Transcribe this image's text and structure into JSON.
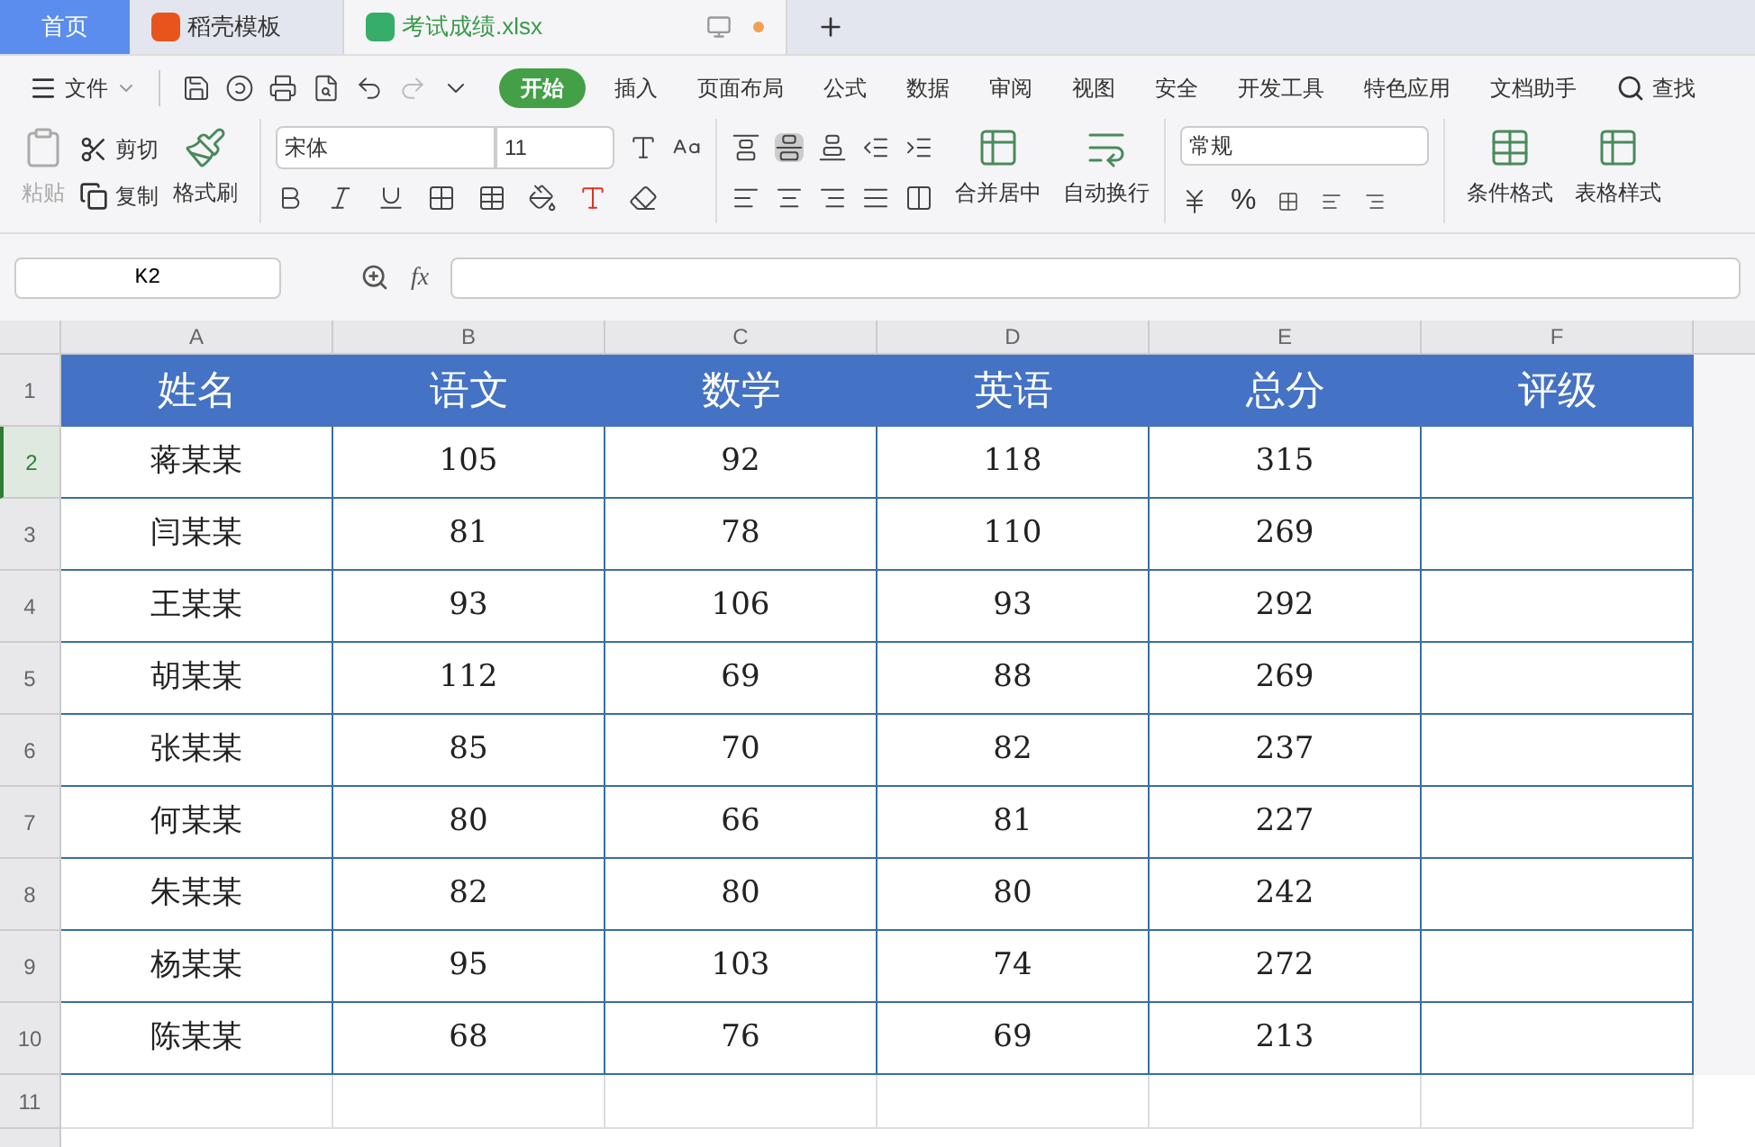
{
  "tabs": [
    {
      "label": "首页",
      "kind": "home",
      "selected": false
    },
    {
      "label": "稻壳模板",
      "kind": "template",
      "selected": false
    },
    {
      "label": "考试成绩.xlsx",
      "kind": "sheet",
      "selected": true
    }
  ],
  "menu": {
    "file": "文件",
    "items": [
      {
        "label": "开始",
        "selected": true
      },
      {
        "label": "插入",
        "selected": false
      },
      {
        "label": "页面布局",
        "selected": false
      },
      {
        "label": "公式",
        "selected": false
      },
      {
        "label": "数据",
        "selected": false
      },
      {
        "label": "审阅",
        "selected": false
      },
      {
        "label": "视图",
        "selected": false
      },
      {
        "label": "安全",
        "selected": false
      },
      {
        "label": "开发工具",
        "selected": false
      },
      {
        "label": "特色应用",
        "selected": false
      },
      {
        "label": "文档助手",
        "selected": false
      }
    ],
    "search": "查找"
  },
  "ribbon": {
    "paste": "粘贴",
    "cut": "剪切",
    "copy": "复制",
    "format_painter": "格式刷",
    "font": "宋体",
    "font_size": "11",
    "merge": "合并居中",
    "wrap": "自动换行",
    "number_format": "常规",
    "percent": "%",
    "conditional_format": "条件格式",
    "table_style": "表格样式"
  },
  "formula_bar": {
    "name_box": "K2",
    "fx": "fx"
  },
  "columns": [
    "A",
    "B",
    "C",
    "D",
    "E",
    "F"
  ],
  "header_row": [
    "姓名",
    "语文",
    "数学",
    "英语",
    "总分",
    "评级"
  ],
  "rows": [
    {
      "number": "2",
      "selected": true,
      "cells": [
        "蒋某某",
        "105",
        "92",
        "118",
        "315",
        ""
      ]
    },
    {
      "number": "3",
      "selected": false,
      "cells": [
        "闫某某",
        "81",
        "78",
        "110",
        "269",
        ""
      ]
    },
    {
      "number": "4",
      "selected": false,
      "cells": [
        "王某某",
        "93",
        "106",
        "93",
        "292",
        ""
      ]
    },
    {
      "number": "5",
      "selected": false,
      "cells": [
        "胡某某",
        "112",
        "69",
        "88",
        "269",
        ""
      ]
    },
    {
      "number": "6",
      "selected": false,
      "cells": [
        "张某某",
        "85",
        "70",
        "82",
        "237",
        ""
      ]
    },
    {
      "number": "7",
      "selected": false,
      "cells": [
        "何某某",
        "80",
        "66",
        "81",
        "227",
        ""
      ]
    },
    {
      "number": "8",
      "selected": false,
      "cells": [
        "朱某某",
        "82",
        "80",
        "80",
        "242",
        ""
      ]
    },
    {
      "number": "9",
      "selected": false,
      "cells": [
        "杨某某",
        "95",
        "103",
        "74",
        "272",
        ""
      ]
    },
    {
      "number": "10",
      "selected": false,
      "cells": [
        "陈某某",
        "68",
        "76",
        "69",
        "213",
        ""
      ]
    }
  ],
  "first_row_number": "1",
  "blank_row_number": "11"
}
